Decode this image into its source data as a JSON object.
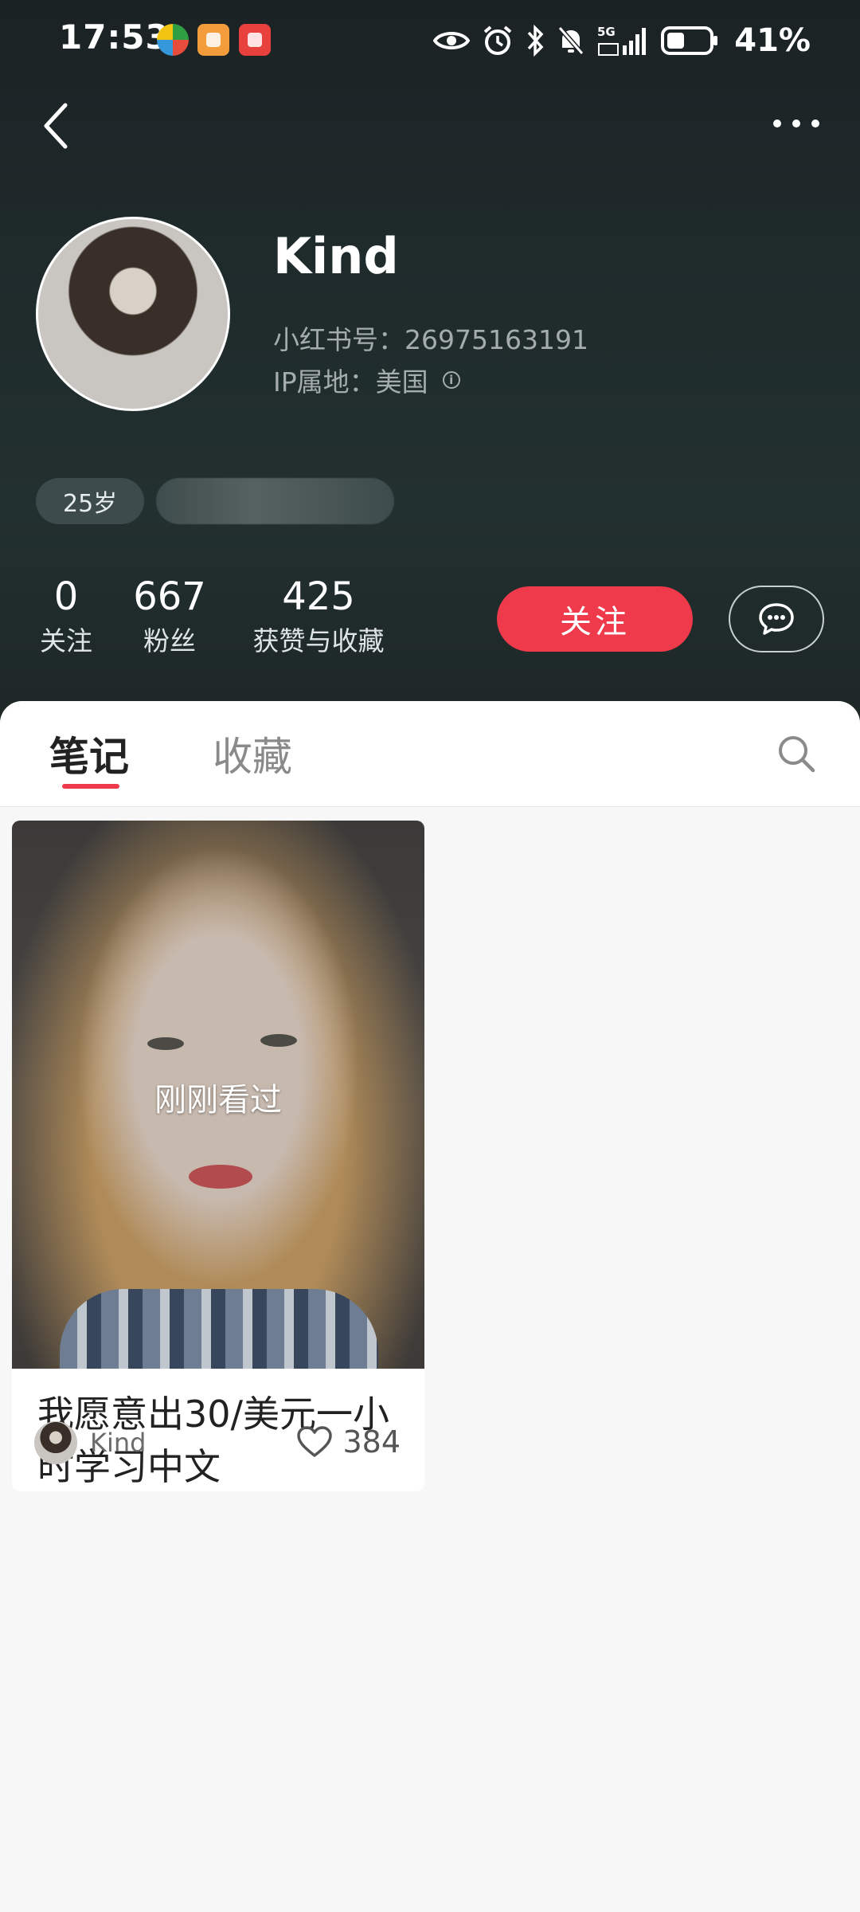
{
  "status_bar": {
    "time": "17:53",
    "network_label": "5G",
    "battery_percent": "41%",
    "battery_level": 0.41,
    "icons": [
      "eye-icon",
      "alarm-icon",
      "bluetooth-icon",
      "bell-off-icon",
      "signal-icon",
      "battery-icon"
    ]
  },
  "nav": {
    "back_icon": "chevron-left-icon",
    "more_icon": "more-dots-icon"
  },
  "profile": {
    "name": "Kind",
    "id_line": "小红书号：26975163191",
    "ip_line": "IP属地：美国",
    "tags": {
      "age": "25岁"
    }
  },
  "stats": [
    {
      "num": "0",
      "label": "关注"
    },
    {
      "num": "667",
      "label": "粉丝"
    },
    {
      "num": "425",
      "label": "获赞与收藏"
    }
  ],
  "actions": {
    "follow_label": "关注",
    "message_icon": "chat-bubble-icon"
  },
  "tabs": {
    "notes": "笔记",
    "collections": "收藏",
    "active": "notes",
    "search_icon": "search-icon"
  },
  "notes": [
    {
      "overlay": "刚刚看过",
      "title": "我愿意出30/美元一小时学习中文",
      "author": "Kind",
      "likes": "384"
    }
  ],
  "colors": {
    "accent": "#ee3a4a",
    "header_bg": "#1f2a2b",
    "panel_bg": "#f7f7f7"
  }
}
